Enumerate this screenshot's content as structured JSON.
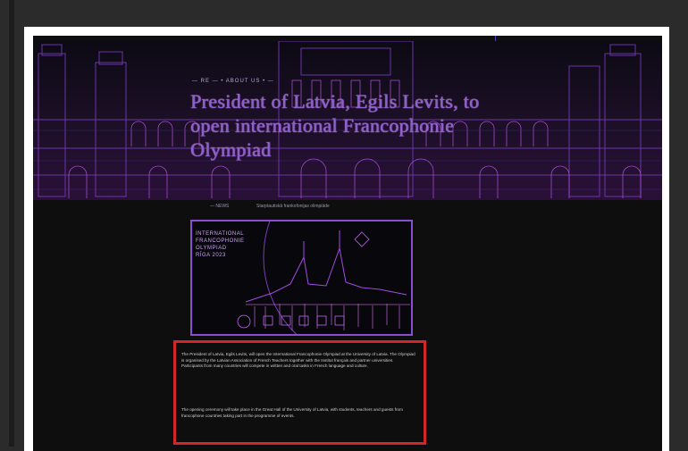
{
  "hero": {
    "kicker": "— RE — • ABOUT US • —",
    "title": "President of Latvia, Egils Levits, to open international Francophonie Olympiad"
  },
  "meta": {
    "date": "— NEWS",
    "link": "Starptautiskā frankofonijas olimpiāde"
  },
  "poster": {
    "caption": "INTERNATIONAL FRANCOPHONIE OLYMPIAD RĪGA 2023"
  },
  "article": {
    "paragraph_1": "The President of Latvia, Egils Levits, will open the International Francophonie Olympiad at the University of Latvia. The Olympiad is organised by the Latvian Association of French Teachers together with the Institut français and partner universities. Participants from many countries will compete in written and oral tasks in French language and culture.",
    "paragraph_2": "The opening ceremony will take place in the Great Hall of the University of Latvia, with students, teachers and guests from francophone countries taking part in the programme of events."
  },
  "colors": {
    "highlight": "#d3262a",
    "accent": "#8a4fd0"
  }
}
